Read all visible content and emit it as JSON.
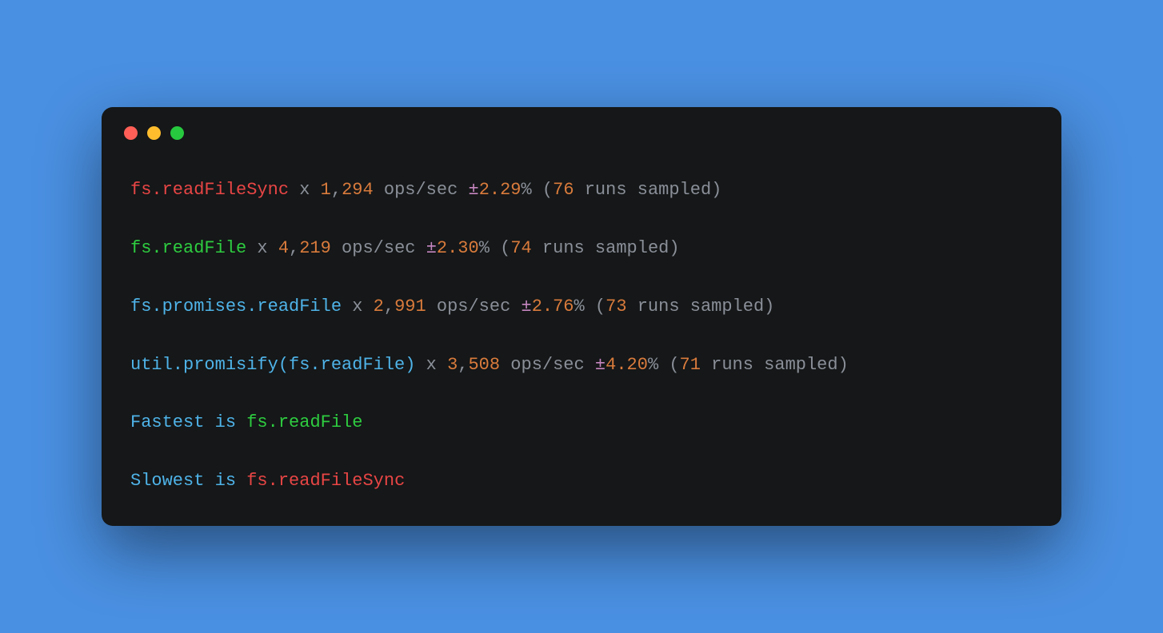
{
  "benchmarks": [
    {
      "name": "fs.readFileSync",
      "name_color": "c-red",
      "ops_int": "1",
      "ops_frac": "294",
      "err": "2.29",
      "runs": "76"
    },
    {
      "name": "fs.readFile",
      "name_color": "c-green",
      "ops_int": "4",
      "ops_frac": "219",
      "err": "2.30",
      "runs": "74"
    },
    {
      "name": "fs.promises.readFile",
      "name_color": "c-blue",
      "ops_int": "2",
      "ops_frac": "991",
      "err": "2.76",
      "runs": "73"
    },
    {
      "name": "util.promisify(fs.readFile)",
      "name_color": "c-blue",
      "ops_int": "3",
      "ops_frac": "508",
      "err": "4.20",
      "runs": "71"
    }
  ],
  "summary": {
    "fastest_label": "Fastest is ",
    "fastest_name": "fs.readFile",
    "slowest_label": "Slowest is ",
    "slowest_name": "fs.readFileSync"
  },
  "tokens": {
    "x": " x ",
    "comma": ",",
    "ops_sec": " ops/sec ",
    "pm": "±",
    "pct": "%",
    "open_paren": " (",
    "runs_sampled": " runs sampled)"
  }
}
